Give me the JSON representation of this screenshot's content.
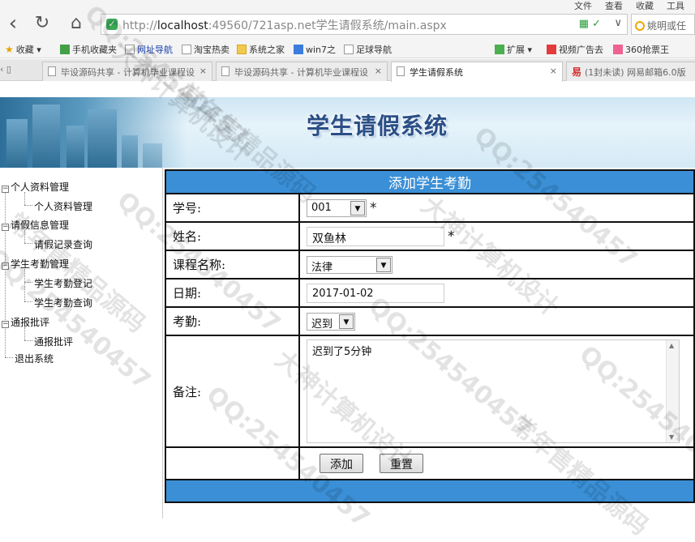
{
  "browser": {
    "menu": [
      "文件",
      "查看",
      "收藏",
      "工具"
    ],
    "url_prefix": "http://",
    "url_host": "localhost",
    "url_rest": ":49560/721asp.net学生请假系统/main.aspx",
    "search_placeholder": "姚明或任",
    "bookmarks": [
      {
        "label": "收藏",
        "icon": "star-icon"
      },
      {
        "label": "手机收藏夹",
        "icon": "phone-icon"
      },
      {
        "label": "网址导航",
        "icon": "page-icon"
      },
      {
        "label": "淘宝热卖",
        "icon": "page-icon"
      },
      {
        "label": "系统之家",
        "icon": "folder-icon"
      },
      {
        "label": "win7之",
        "icon": "globe-icon"
      },
      {
        "label": "足球导航",
        "icon": "page-icon"
      },
      {
        "label": "扩展",
        "icon": "extension-icon"
      },
      {
        "label": "视频广告去",
        "icon": "video-icon"
      },
      {
        "label": "360抢票王",
        "icon": "ticket-icon"
      }
    ],
    "tabs": [
      {
        "label": "毕设源码共享 - 计算机毕业课程设",
        "active": false
      },
      {
        "label": "毕设源码共享 - 计算机毕业课程设",
        "active": false
      },
      {
        "label": "学生请假系统",
        "active": true
      },
      {
        "label": "(1封未读) 网易邮箱6.0版",
        "active": false
      }
    ]
  },
  "page": {
    "banner_title": "学生请假系统",
    "tree": [
      {
        "label": "个人资料管理",
        "children": [
          "个人资料管理"
        ]
      },
      {
        "label": "请假信息管理",
        "children": [
          "请假记录查询"
        ]
      },
      {
        "label": "学生考勤管理",
        "children": [
          "学生考勤登记",
          "学生考勤查询"
        ]
      },
      {
        "label": "通报批评",
        "children": [
          "通报批评"
        ]
      },
      {
        "label": "退出系统",
        "children": []
      }
    ],
    "form": {
      "title": "添加学生考勤",
      "student_id_label": "学号:",
      "student_id_value": "001",
      "name_label": "姓名:",
      "name_value": "双鱼林",
      "course_label": "课程名称:",
      "course_value": "法律",
      "date_label": "日期:",
      "date_value": "2017-01-02",
      "attendance_label": "考勤:",
      "attendance_value": "迟到",
      "remark_label": "备注:",
      "remark_value": "迟到了5分钟",
      "required_mark": "*",
      "add_button": "添加",
      "reset_button": "重置"
    }
  },
  "watermarks": [
    "QQ:254540457",
    "大神计算机设计",
    "常年售精品源码"
  ]
}
